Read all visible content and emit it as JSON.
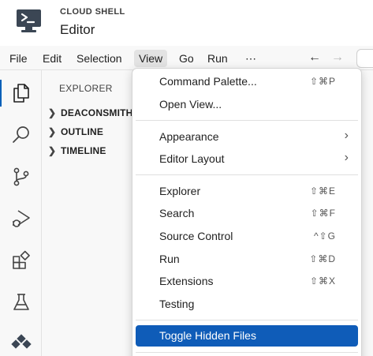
{
  "header": {
    "subtitle": "CLOUD SHELL",
    "title": "Editor"
  },
  "menubar": {
    "items": [
      "File",
      "Edit",
      "Selection",
      "View",
      "Go",
      "Run",
      "⋯"
    ],
    "active": "View",
    "back_icon": "arrow-left-icon",
    "forward_icon": "arrow-right-icon"
  },
  "activitybar": {
    "icons": [
      "files-icon",
      "search-icon",
      "source-control-icon",
      "run-debug-icon",
      "extensions-icon",
      "testing-icon",
      "remote-icon"
    ],
    "active": "files-icon"
  },
  "explorer": {
    "title": "EXPLORER",
    "sections": [
      "DEACONSMITH",
      "OUTLINE",
      "TIMELINE"
    ]
  },
  "view_menu": {
    "groups": [
      [
        {
          "label": "Command Palette...",
          "shortcut": "⇧⌘P"
        },
        {
          "label": "Open View...",
          "shortcut": ""
        }
      ],
      [
        {
          "label": "Appearance",
          "submenu": true
        },
        {
          "label": "Editor Layout",
          "submenu": true
        }
      ],
      [
        {
          "label": "Explorer",
          "shortcut": "⇧⌘E"
        },
        {
          "label": "Search",
          "shortcut": "⇧⌘F"
        },
        {
          "label": "Source Control",
          "shortcut": "^⇧G"
        },
        {
          "label": "Run",
          "shortcut": "⇧⌘D"
        },
        {
          "label": "Extensions",
          "shortcut": "⇧⌘X"
        },
        {
          "label": "Testing",
          "shortcut": ""
        }
      ],
      [
        {
          "label": "Toggle Hidden Files",
          "shortcut": "",
          "highlighted": true
        }
      ]
    ]
  },
  "colors": {
    "accent": "#0f5cb8",
    "logo": "#3b4654"
  }
}
